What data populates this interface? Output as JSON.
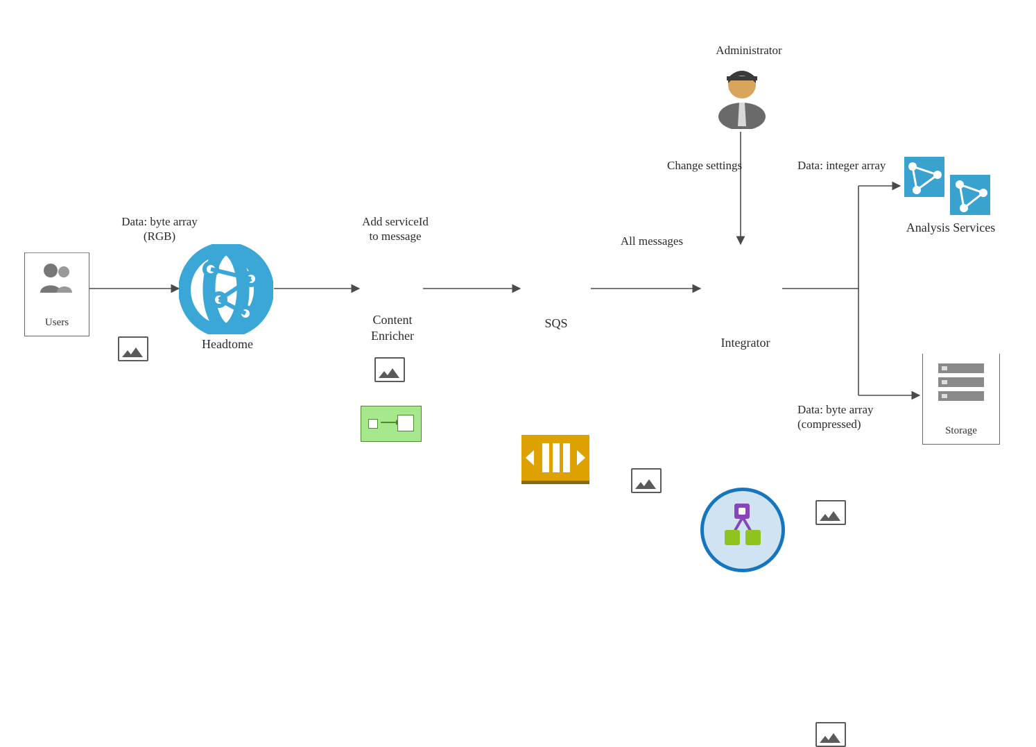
{
  "nodes": {
    "users": {
      "label": "Users"
    },
    "headtome": {
      "label": "Headtome"
    },
    "content_enricher": {
      "label": "Content\nEnricher"
    },
    "sqs": {
      "label": "SQS"
    },
    "integrator": {
      "label": "Integrator"
    },
    "administrator": {
      "label": "Administrator"
    },
    "analysis_services": {
      "label": "Analysis Services"
    },
    "storage": {
      "label": "Storage"
    }
  },
  "edges": {
    "users_to_headtome": {
      "label": "Data: byte array\n(RGB)"
    },
    "headtome_to_enricher": {
      "label": "Add serviceId\nto message"
    },
    "enricher_to_sqs": {
      "label": ""
    },
    "sqs_to_integrator": {
      "label": "All messages"
    },
    "admin_to_integrator": {
      "label": "Change settings"
    },
    "integrator_to_analysis": {
      "label": "Data: integer array"
    },
    "integrator_to_storage": {
      "label": "Data: byte array\n(compressed)"
    }
  }
}
